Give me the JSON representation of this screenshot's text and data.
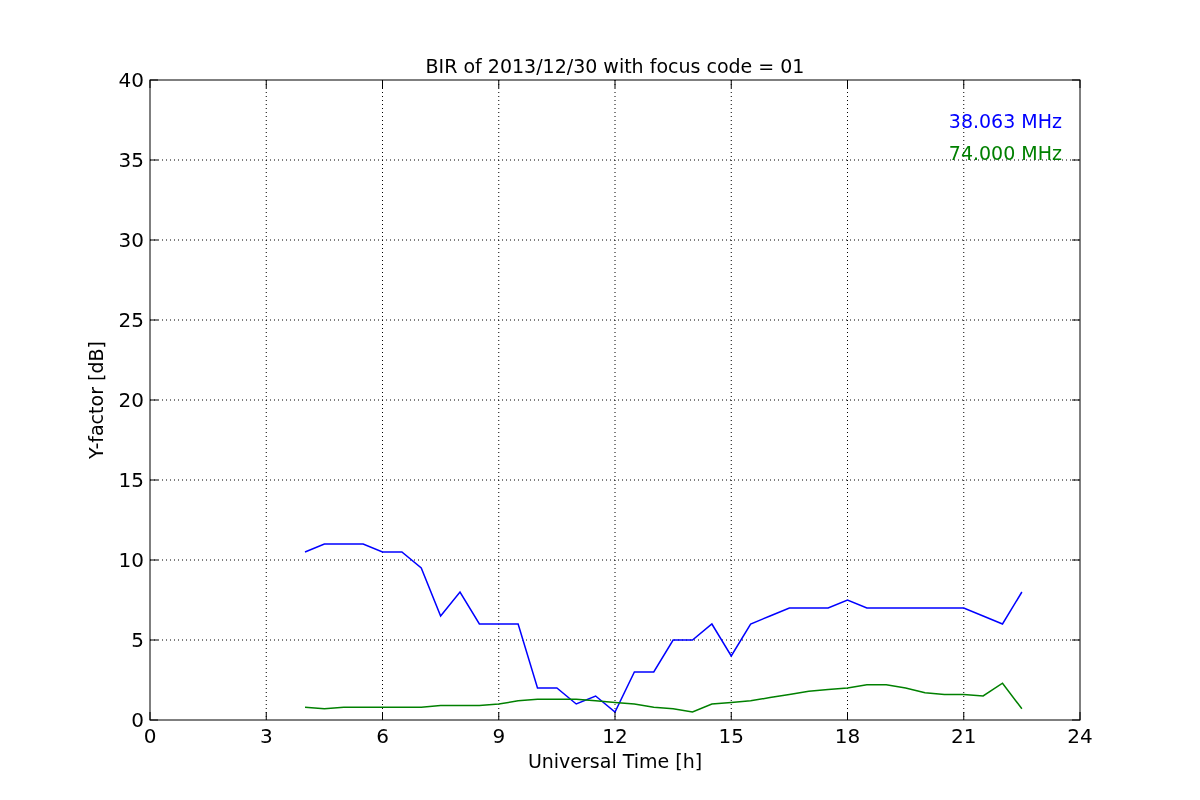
{
  "figure": {
    "chart_data": {
      "type": "line",
      "title": "BIR of 2013/12/30 with focus code = 01",
      "xlabel": "Universal Time [h]",
      "ylabel": "Y-factor [dB]",
      "x": [
        4,
        4.5,
        5,
        5.5,
        6,
        6.5,
        7,
        7.5,
        8,
        8.5,
        9,
        9.5,
        10,
        10.5,
        11,
        11.5,
        12,
        12.5,
        13,
        13.5,
        14,
        14.5,
        15,
        15.5,
        16,
        16.5,
        17,
        17.5,
        18,
        18.5,
        19,
        19.5,
        20,
        20.5,
        21,
        21.5,
        22,
        22.5
      ],
      "series": [
        {
          "name": "38.063 MHz",
          "color": "#0000ff",
          "values": [
            10.5,
            11,
            11,
            11,
            10.5,
            10.5,
            9.5,
            6.5,
            8,
            6,
            6,
            6,
            2,
            2,
            1,
            1.5,
            0.5,
            3,
            3,
            5,
            5,
            6,
            4,
            6,
            6.5,
            7,
            7,
            7,
            7.5,
            7,
            7,
            7,
            7,
            7,
            7,
            6.5,
            6,
            8
          ]
        },
        {
          "name": "74.000 MHz",
          "color": "#008000",
          "values": [
            0.8,
            0.7,
            0.8,
            0.8,
            0.8,
            0.8,
            0.8,
            0.9,
            0.9,
            0.9,
            1,
            1.2,
            1.3,
            1.3,
            1.3,
            1.2,
            1.1,
            1,
            0.8,
            0.7,
            0.5,
            1,
            1.1,
            1.2,
            1.4,
            1.6,
            1.8,
            1.9,
            2,
            2.2,
            2.2,
            2,
            1.7,
            1.6,
            1.6,
            1.5,
            2.3,
            0.7
          ]
        }
      ],
      "grid": true,
      "xlim": [
        0,
        24
      ],
      "ylim": [
        0,
        40
      ],
      "xticks": [
        0,
        3,
        6,
        9,
        12,
        15,
        18,
        21,
        24
      ],
      "yticks": [
        0,
        5,
        10,
        15,
        20,
        25,
        30,
        35,
        40
      ]
    }
  }
}
